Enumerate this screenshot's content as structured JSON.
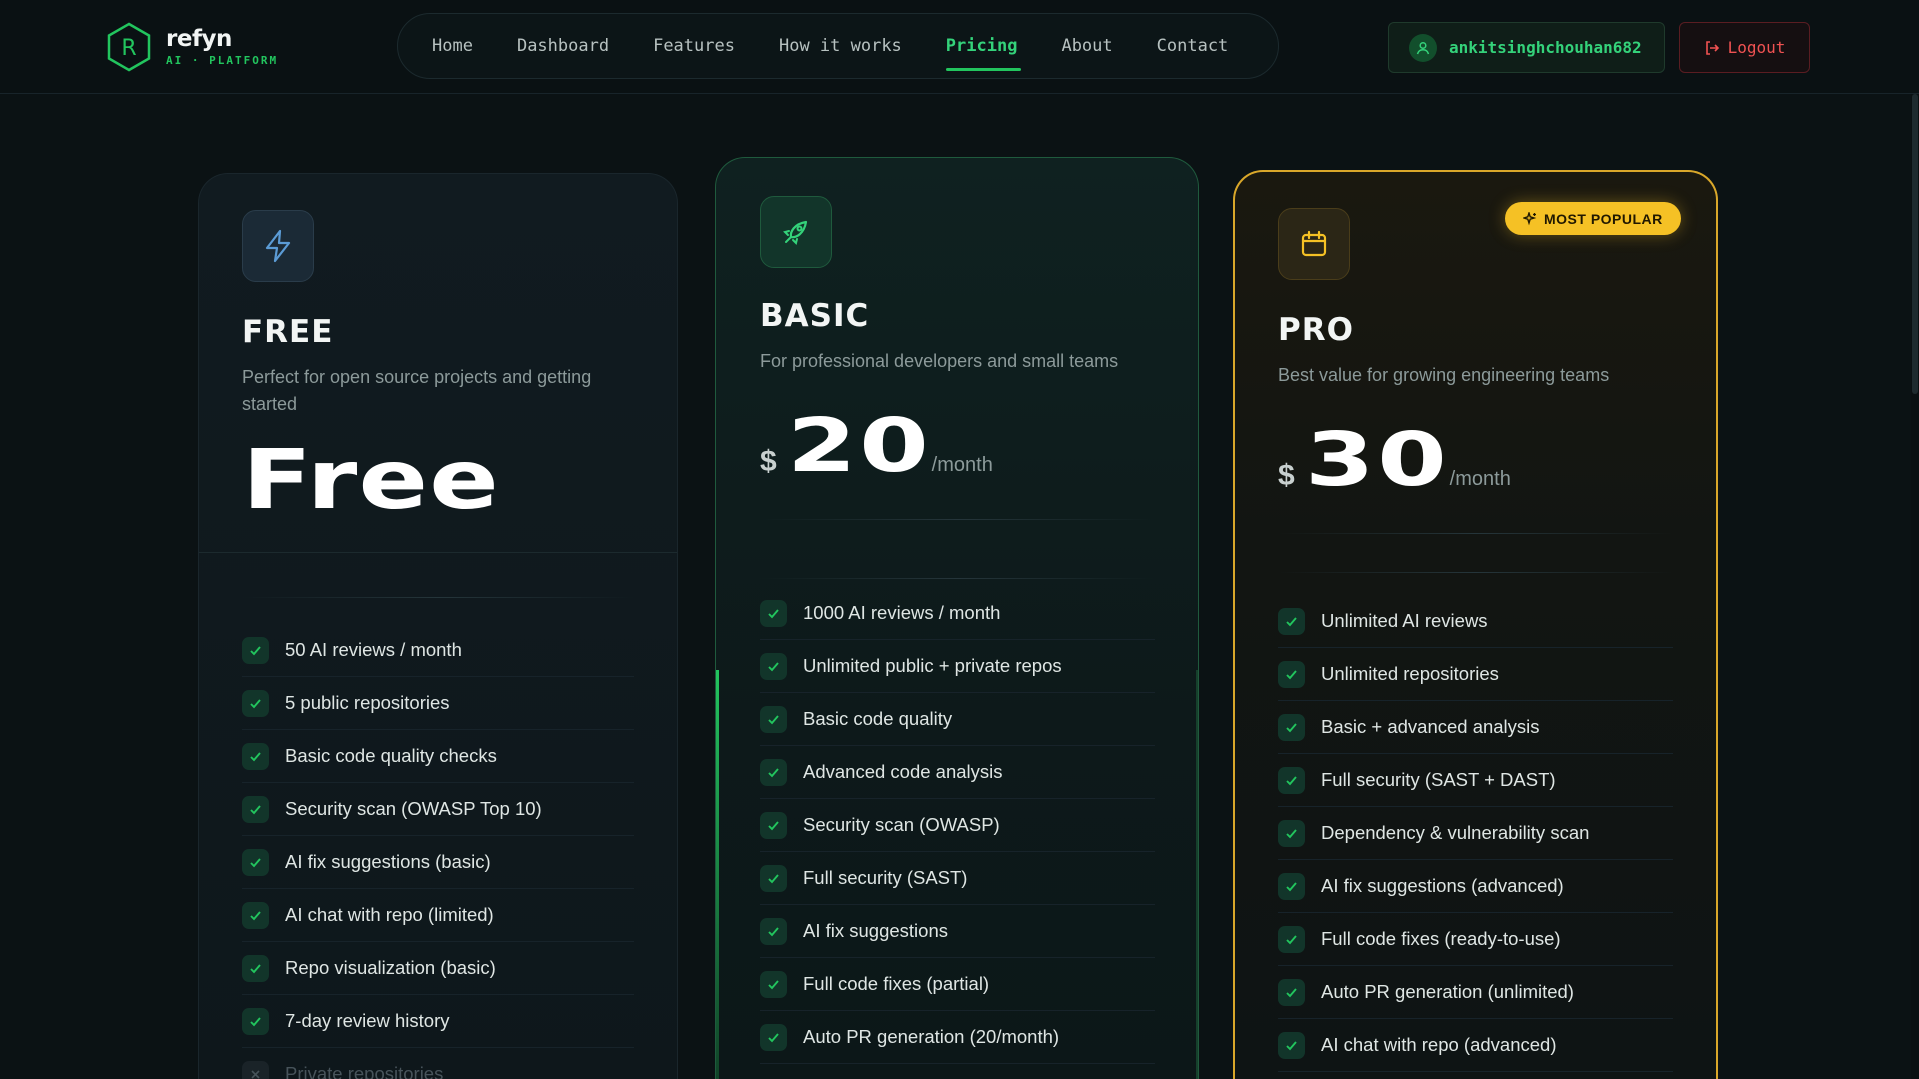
{
  "brand": {
    "name": "refyn",
    "tagline": "AI · PLATFORM"
  },
  "nav": {
    "items": [
      {
        "label": "Home"
      },
      {
        "label": "Dashboard"
      },
      {
        "label": "Features"
      },
      {
        "label": "How it works"
      },
      {
        "label": "Pricing",
        "active": true
      },
      {
        "label": "About"
      },
      {
        "label": "Contact"
      }
    ]
  },
  "user": {
    "name": "ankitsinghchouhan682",
    "logout_label": "Logout"
  },
  "colors": {
    "accent": "#22c55e",
    "pro_border": "#d9a72a",
    "badge": "#f5c125",
    "danger": "#f05252"
  },
  "plans": [
    {
      "name": "FREE",
      "icon": "lightning-icon",
      "description": "Perfect for open source projects and getting started",
      "price_text": "Free",
      "features": [
        "50 AI reviews / month",
        "5 public repositories",
        "Basic code quality checks",
        "Security scan (OWASP Top 10)",
        "AI fix suggestions (basic)",
        "AI chat with repo (limited)",
        "Repo visualization (basic)",
        "7-day review history",
        "Private repositories"
      ]
    },
    {
      "name": "BASIC",
      "icon": "rocket-icon",
      "description": "For professional developers and small teams",
      "currency": "$",
      "price": "20",
      "period": "/month",
      "features": [
        "1000 AI reviews / month",
        "Unlimited public + private repos",
        "Basic code quality",
        "Advanced code analysis",
        "Security scan (OWASP)",
        "Full security (SAST)",
        "AI fix suggestions",
        "Full code fixes (partial)",
        "Auto PR generation (20/month)"
      ]
    },
    {
      "name": "PRO",
      "icon": "calendar-icon",
      "badge": "MOST POPULAR",
      "description": "Best value for growing engineering teams",
      "currency": "$",
      "price": "30",
      "period": "/month",
      "features": [
        "Unlimited AI reviews",
        "Unlimited repositories",
        "Basic + advanced analysis",
        "Full security (SAST + DAST)",
        "Dependency & vulnerability scan",
        "AI fix suggestions (advanced)",
        "Full code fixes (ready-to-use)",
        "Auto PR generation (unlimited)",
        "AI chat with repo (advanced)"
      ]
    }
  ]
}
